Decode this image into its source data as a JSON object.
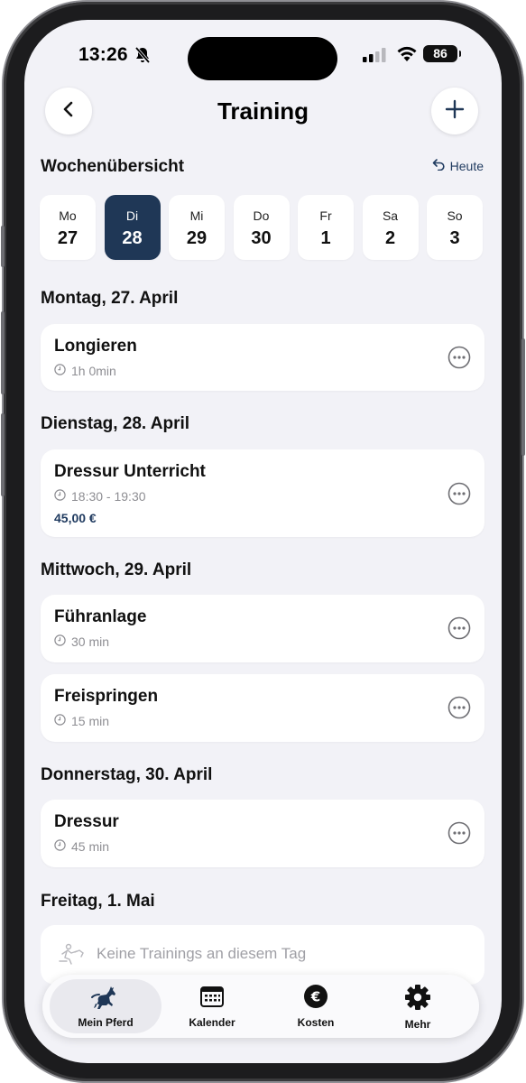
{
  "status_bar": {
    "time": "13:26",
    "battery": "86"
  },
  "header": {
    "title": "Training"
  },
  "week": {
    "label": "Wochenübersicht",
    "today_label": "Heute",
    "days": [
      {
        "name": "Mo",
        "date": "27",
        "selected": false
      },
      {
        "name": "Di",
        "date": "28",
        "selected": true
      },
      {
        "name": "Mi",
        "date": "29",
        "selected": false
      },
      {
        "name": "Do",
        "date": "30",
        "selected": false
      },
      {
        "name": "Fr",
        "date": "1",
        "selected": false
      },
      {
        "name": "Sa",
        "date": "2",
        "selected": false
      },
      {
        "name": "So",
        "date": "3",
        "selected": false
      }
    ]
  },
  "days": [
    {
      "heading": "Montag, 27. April",
      "entries": [
        {
          "title": "Longieren",
          "time": "1h 0min"
        }
      ]
    },
    {
      "heading": "Dienstag, 28. April",
      "entries": [
        {
          "title": "Dressur Unterricht",
          "time": "18:30 - 19:30",
          "price": "45,00 €"
        }
      ]
    },
    {
      "heading": "Mittwoch, 29. April",
      "entries": [
        {
          "title": "Führanlage",
          "time": "30 min"
        },
        {
          "title": "Freispringen",
          "time": "15 min"
        }
      ]
    },
    {
      "heading": "Donnerstag, 30. April",
      "entries": [
        {
          "title": "Dressur",
          "time": "45 min"
        }
      ]
    },
    {
      "heading": "Freitag, 1. Mai",
      "empty_text": "Keine Trainings an diesem Tag"
    }
  ],
  "tabbar": {
    "tabs": [
      {
        "label": "Mein Pferd",
        "icon": "horse-icon",
        "active": true
      },
      {
        "label": "Kalender",
        "icon": "calendar-icon",
        "active": false
      },
      {
        "label": "Kosten",
        "icon": "euro-icon",
        "active": false
      },
      {
        "label": "Mehr",
        "icon": "gear-icon",
        "active": false
      }
    ]
  },
  "colors": {
    "accent": "#1f3756",
    "background": "#f2f2f7",
    "price": "#1f3a5f"
  }
}
